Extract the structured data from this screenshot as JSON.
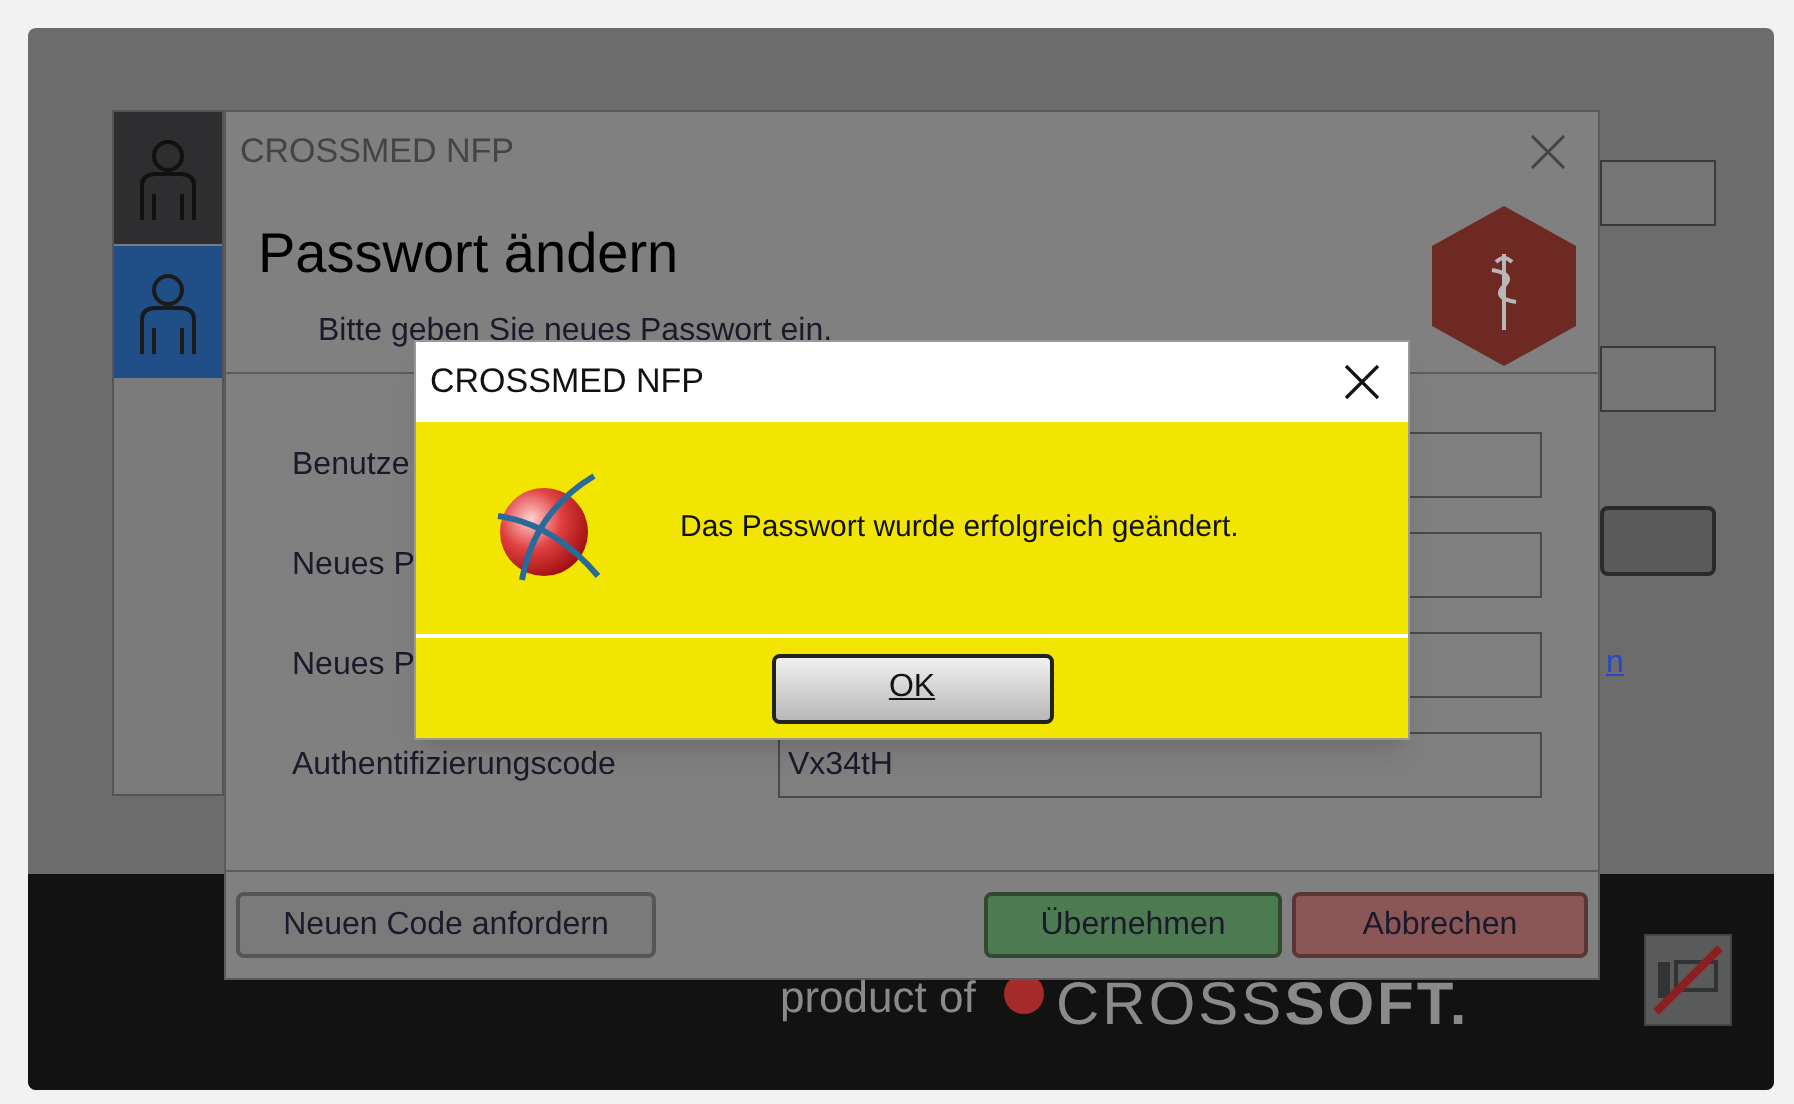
{
  "app": {
    "footer_text": "product of",
    "footer_brand": "CROSS**SOFT.**",
    "link_fragment": "n"
  },
  "sidebar": {
    "items": [
      {
        "selected": false
      },
      {
        "selected": true
      }
    ]
  },
  "dialog": {
    "title": "CROSSMED NFP",
    "heading": "Passwort ändern",
    "subtitle": "Bitte geben Sie neues Passwort ein.",
    "fields": [
      {
        "label": "Benutze"
      },
      {
        "label": "Neues P"
      },
      {
        "label": "Neues P"
      },
      {
        "label": "Authentifizierungscode",
        "value": "Vx34tH"
      }
    ],
    "buttons": [
      {
        "label": "Neuen Code anfordern",
        "kind": "neutral"
      },
      {
        "label": "Übernehmen",
        "kind": "confirm"
      },
      {
        "label": "Abbrechen",
        "kind": "cancel"
      }
    ]
  },
  "message_box": {
    "title": "CROSSMED NFP",
    "message": "Das Passwort wurde erfolgreich geändert.",
    "button": "OK"
  }
}
